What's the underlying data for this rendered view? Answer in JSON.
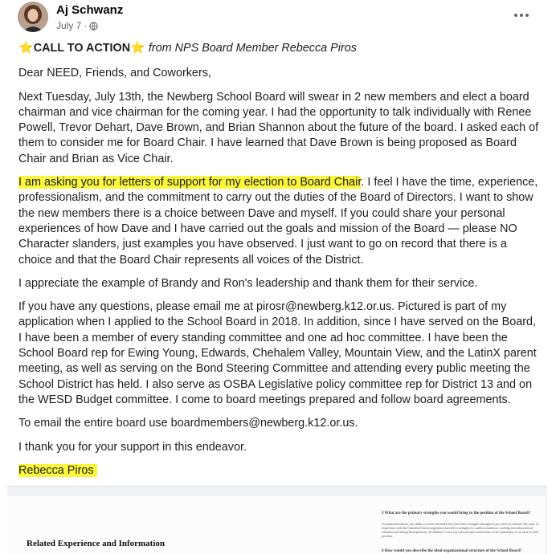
{
  "post": {
    "author": "Aj Schwanz",
    "date": "July 7",
    "meta_separator": "·",
    "privacy_icon": "globe-icon",
    "more_icon": "ellipsis-icon",
    "cta_label": "CALL TO ACTION",
    "cta_star_icon": "⭐",
    "cta_from": "from NPS Board Member Rebecca Piros",
    "greeting": "Dear NEED, Friends, and Coworkers,",
    "para1": "Next Tuesday, July 13th, the Newberg School Board will swear in 2 new members and elect a board chairman and vice chairman for the coming year. I had the opportunity to talk individually with Renee Powell, Trevor Dehart, Dave Brown, and Brian Shannon about the future of the board. I asked each of them to consider me for Board Chair. I have learned that Dave Brown is being proposed as Board Chair and Brian as Vice Chair.",
    "para2_highlight": "I am asking you for letters of support for my election to Board Chair",
    "para2_rest": ". I feel I have the time, experience, professionalism, and the commitment to carry out the duties of the Board of Directors. I want to show the new members there is a choice between Dave and myself. If you could share your personal experiences of how Dave and I have carried out the goals and mission of the Board — please NO Character slanders, just examples you have observed. I just want to go on record that there is a choice and that the Board Chair represents all voices of the District.",
    "para3": "I appreciate the example of Brandy and Ron's leadership and thank them for their service.",
    "para4": "If you have any questions, please email me at pirosr@newberg.k12.or.us. Pictured is part of my application when I applied to the School Board in 2018. In addition, since I have served on the Board, I have been a member of every standing committee and one ad hoc committee. I have been the School Board rep for Ewing Young, Edwards, Chehalem Valley, Mountain View, and the LatinX parent meeting, as well as serving on the Bond Steering Committee and attending every public meeting the School District has held. I also serve as OSBA Legislative policy committee rep for District 13 and on the WESD Budget committee. I come to board meetings prepared and follow board agreements.",
    "para5": "To email the entire board use boardmembers@newberg.k12.or.us.",
    "para6": "I thank you for your support in this endeavor.",
    "signature": "Rebecca Piros"
  },
  "attached_image": {
    "title": "Related Experience and Information",
    "question1": "3 What are the primary strengths you would bring to the position of the School Board?",
    "answer1": "As mentioned above, my ability to listen and build trust have been strengths throughout my career in schools. My years of experience with the Classified Union negotiation has led to strengths in conflict resolution, working towards practical solutions and asking hard questions. In addition, I view my network and connections in the community as an asset for this position.",
    "question2": "6 How would you describe the ideal organizational structure of the School Board?"
  }
}
